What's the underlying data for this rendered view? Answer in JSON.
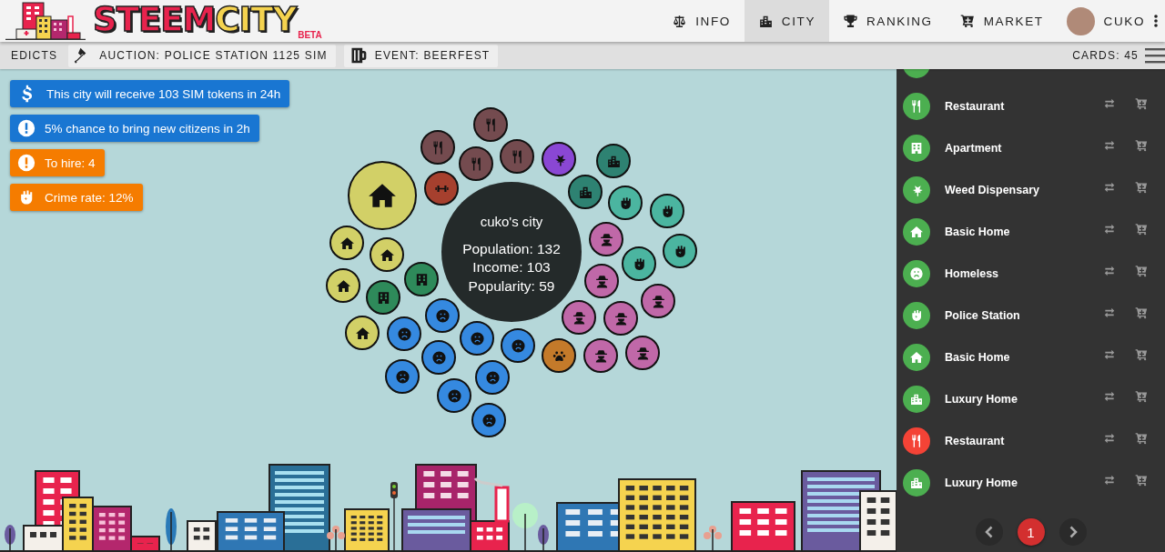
{
  "header": {
    "logo": {
      "text_1": "STEEM",
      "text_2": "CITY",
      "badge": "BETA"
    },
    "nav": [
      {
        "label": "INFO",
        "selected": false
      },
      {
        "label": "CITY",
        "selected": true
      },
      {
        "label": "RANKING",
        "selected": false
      },
      {
        "label": "MARKET",
        "selected": false
      }
    ],
    "user": {
      "name": "CUKO"
    }
  },
  "subbar": {
    "items": [
      {
        "kind": "plain",
        "label": "EDICTS"
      },
      {
        "kind": "auction",
        "label": "AUCTION: POLICE STATION 1125 SIM"
      },
      {
        "kind": "event",
        "label": "EVENT: BEERFEST"
      }
    ],
    "cards": "CARDS: 45"
  },
  "notices": [
    {
      "kind": "income",
      "text": "This city will receive 103 SIM tokens in 24h",
      "color": "#1976d2"
    },
    {
      "kind": "alert",
      "text": "5% chance to bring new citizens in 2h",
      "color": "#1976d2"
    },
    {
      "kind": "alert",
      "text": "To hire: 4",
      "color": "#f57c00"
    },
    {
      "kind": "crime",
      "text": "Crime rate: 12%",
      "color": "#f57c00"
    }
  ],
  "city": {
    "name": "cuko's city",
    "stats": [
      "Population: 132",
      "Income: 103",
      "Popularity: 59"
    ],
    "bubbles": [
      {
        "kind": "restaurant",
        "large": false,
        "color": "#744b4f"
      },
      {
        "kind": "restaurant",
        "large": false,
        "color": "#744b4f"
      },
      {
        "kind": "luxury",
        "large": false,
        "color": "#2e8272"
      },
      {
        "kind": "restaurant",
        "large": false,
        "color": "#744b4f"
      },
      {
        "kind": "weed",
        "large": false,
        "color": "#8a47d4"
      },
      {
        "kind": "restaurant",
        "large": false,
        "color": "#744b4f"
      },
      {
        "kind": "gym",
        "large": false,
        "color": "#a6402e"
      },
      {
        "kind": "luxury",
        "large": false,
        "color": "#2e8272"
      },
      {
        "kind": "house",
        "large": true,
        "color": "#d2d067"
      },
      {
        "kind": "police",
        "large": false,
        "color": "#4bb5a0"
      },
      {
        "kind": "police",
        "large": false,
        "color": "#4bb5a0"
      },
      {
        "kind": "criminal",
        "large": false,
        "color": "#c068a8"
      },
      {
        "kind": "house",
        "large": false,
        "color": "#d2d067"
      },
      {
        "kind": "police",
        "large": false,
        "color": "#4bb5a0"
      },
      {
        "kind": "house",
        "large": false,
        "color": "#d2d067"
      },
      {
        "kind": "police",
        "large": false,
        "color": "#4bb5a0"
      },
      {
        "kind": "apartment",
        "large": false,
        "color": "#2e8a5a"
      },
      {
        "kind": "criminal",
        "large": false,
        "color": "#c068a8"
      },
      {
        "kind": "house",
        "large": false,
        "color": "#d2d067"
      },
      {
        "kind": "apartment",
        "large": false,
        "color": "#2e8a5a"
      },
      {
        "kind": "criminal",
        "large": false,
        "color": "#c068a8"
      },
      {
        "kind": "homeless",
        "large": false,
        "color": "#3589e0"
      },
      {
        "kind": "criminal",
        "large": false,
        "color": "#c068a8"
      },
      {
        "kind": "criminal",
        "large": false,
        "color": "#c068a8"
      },
      {
        "kind": "house",
        "large": false,
        "color": "#d2d067"
      },
      {
        "kind": "homeless",
        "large": false,
        "color": "#3589e0"
      },
      {
        "kind": "homeless",
        "large": false,
        "color": "#3589e0"
      },
      {
        "kind": "homeless",
        "large": false,
        "color": "#3589e0"
      },
      {
        "kind": "pet",
        "large": false,
        "color": "#c47a2a"
      },
      {
        "kind": "criminal",
        "large": false,
        "color": "#c068a8"
      },
      {
        "kind": "criminal",
        "large": false,
        "color": "#c068a8"
      },
      {
        "kind": "homeless",
        "large": false,
        "color": "#3589e0"
      },
      {
        "kind": "homeless",
        "large": false,
        "color": "#3589e0"
      },
      {
        "kind": "homeless",
        "large": false,
        "color": "#3589e0"
      },
      {
        "kind": "homeless",
        "large": false,
        "color": "#3589e0"
      },
      {
        "kind": "homeless",
        "large": false,
        "color": "#3589e0"
      }
    ]
  },
  "cards": {
    "items": [
      {
        "color": "#4caf50"
      },
      {
        "kind": "restaurant",
        "label": "Restaurant",
        "color": "#4caf50"
      },
      {
        "kind": "apartment",
        "label": "Apartment",
        "color": "#4caf50"
      },
      {
        "kind": "weed",
        "label": "Weed Dispensary",
        "color": "#4caf50"
      },
      {
        "kind": "house",
        "label": "Basic Home",
        "color": "#4caf50"
      },
      {
        "kind": "homeless",
        "label": "Homeless",
        "color": "#4caf50"
      },
      {
        "kind": "police",
        "label": "Police Station",
        "color": "#4caf50"
      },
      {
        "kind": "house",
        "label": "Basic Home",
        "color": "#4caf50"
      },
      {
        "kind": "luxury",
        "label": "Luxury Home",
        "color": "#4caf50"
      },
      {
        "kind": "restaurant",
        "label": "Restaurant",
        "color": "#f44336"
      },
      {
        "kind": "luxury",
        "label": "Luxury Home",
        "color": "#4caf50"
      }
    ],
    "pagination": {
      "pages": [
        {
          "label": "1",
          "selected": true
        }
      ]
    }
  }
}
